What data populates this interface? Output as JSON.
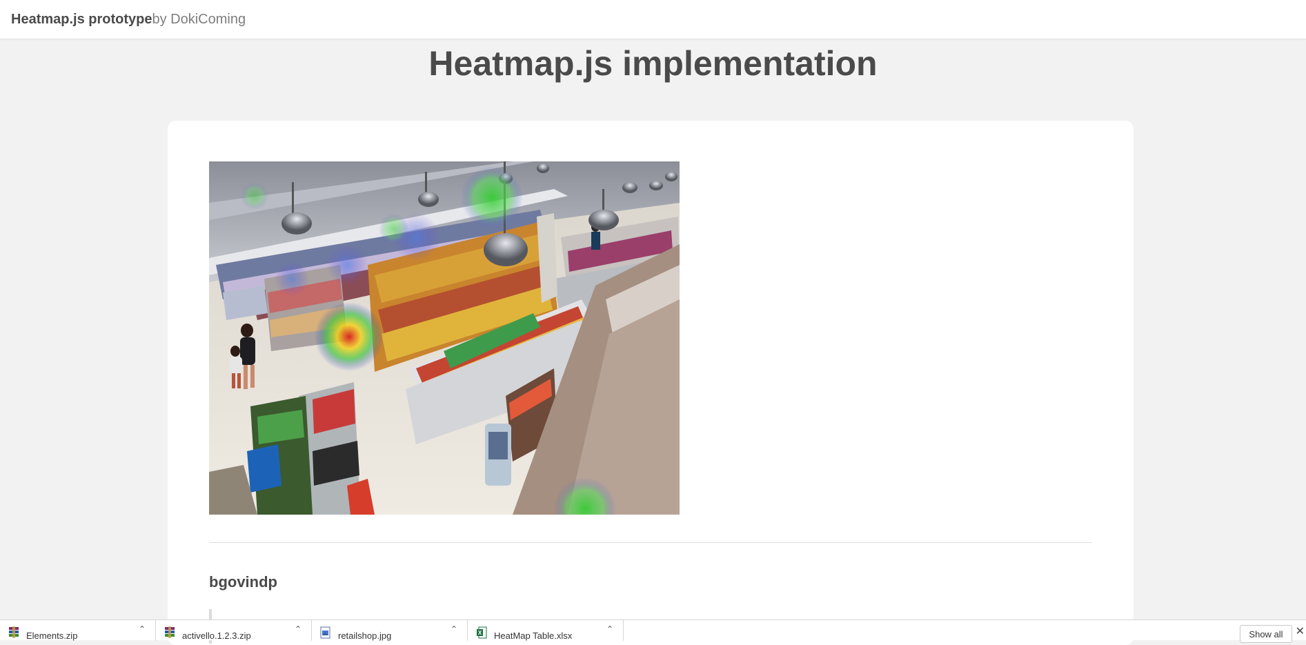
{
  "navbar": {
    "brand": "Heatmap.js prototype",
    "brand_by": "by DokiComing"
  },
  "page": {
    "title": "Heatmap.js implementation"
  },
  "card": {
    "author": "bgovindp"
  },
  "downloads": {
    "items": [
      {
        "name": "Elements.zip",
        "icon": "winrar-archive-icon"
      },
      {
        "name": "activello.1.2.3.zip",
        "icon": "winrar-archive-icon"
      },
      {
        "name": "retailshop.jpg",
        "icon": "image-file-icon"
      },
      {
        "name": "HeatMap Table.xlsx",
        "icon": "excel-file-icon"
      }
    ],
    "show_all": "Show all",
    "close_glyph": "✕"
  },
  "colors": {
    "page_bg": "#f2f2f2",
    "card_bg": "#ffffff",
    "title_text": "#4a4a4a"
  }
}
